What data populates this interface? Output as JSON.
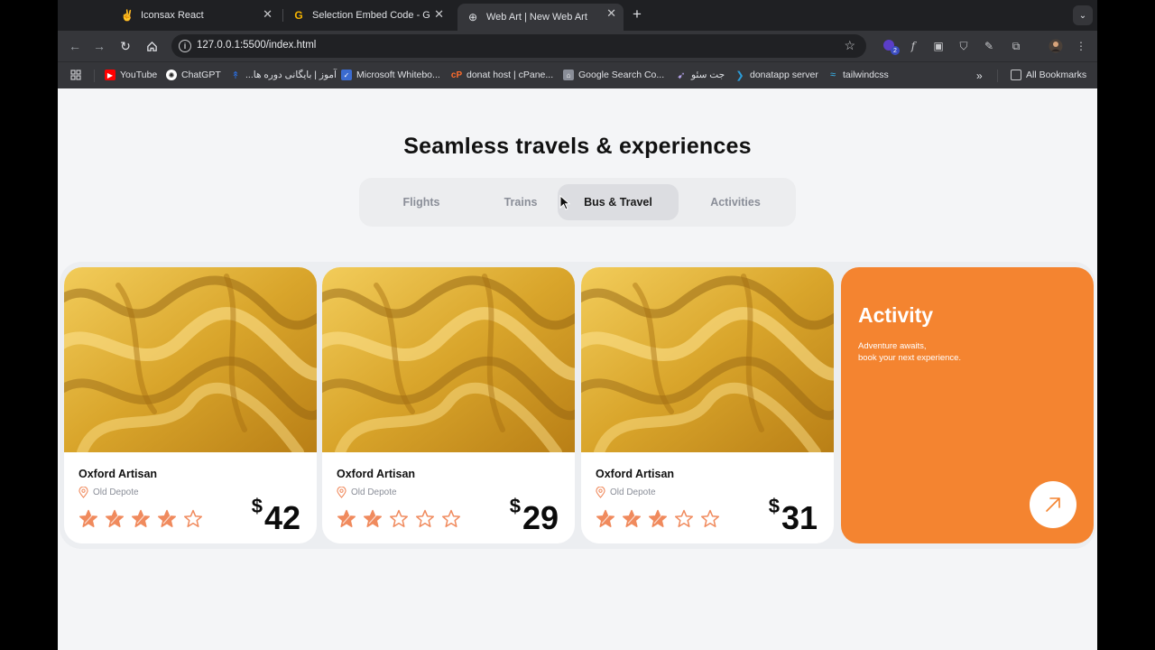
{
  "browser": {
    "tabs": [
      {
        "icon": "✌",
        "title": "Iconsax React"
      },
      {
        "icon": "G",
        "title": "Selection Embed Code - Goo"
      },
      {
        "icon": "⊕",
        "title": "Web Art | New Web Art"
      }
    ],
    "new_tab": "+",
    "url": "127.0.0.1:5500/index.html",
    "extension_badge": "2",
    "bookmarks": [
      {
        "label": "YouTube",
        "color": "#ff0000"
      },
      {
        "label": "ChatGPT",
        "color": "#5a5a5a"
      },
      {
        "label": "...آموز | بایگانی دوره ها",
        "color": "#2b6bd6"
      },
      {
        "label": "Microsoft Whitebo...",
        "color": "#3b6bd0"
      },
      {
        "label": "donat host | cPane...",
        "color": "#ff6c2c"
      },
      {
        "label": "Google Search Co...",
        "color": "#6b6b6b"
      },
      {
        "label": "جت سئو",
        "color": "#7a5cc7"
      },
      {
        "label": "donatapp server",
        "color": "#2b9cd8"
      },
      {
        "label": "tailwindcss",
        "color": "#38bdf8"
      }
    ],
    "all_bookmarks": "All Bookmarks"
  },
  "page": {
    "heading": "Seamless travels & experiences",
    "tabs": [
      "Flights",
      "Trains",
      "Bus & Travel",
      "Activities"
    ],
    "active_tab": "Bus & Travel",
    "cards": [
      {
        "title": "Oxford Artisan",
        "location": "Old Depote",
        "currency": "$",
        "price": "42",
        "rating": 4
      },
      {
        "title": "Oxford Artisan",
        "location": "Old Depote",
        "currency": "$",
        "price": "29",
        "rating": 2
      },
      {
        "title": "Oxford Artisan",
        "location": "Old Depote",
        "currency": "$",
        "price": "31",
        "rating": 3
      }
    ],
    "promo": {
      "title": "Activity",
      "line1": "Adventure awaits,",
      "line2": "book your next experience."
    }
  },
  "colors": {
    "accent": "#f48430",
    "star": "#f08a5d",
    "gold": "#e0a92c"
  }
}
